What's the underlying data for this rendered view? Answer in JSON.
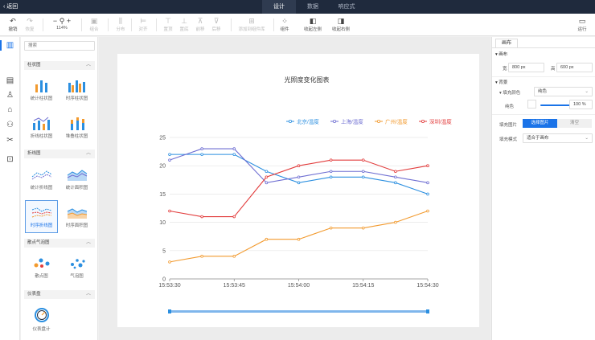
{
  "topbar": {
    "back_label": "返回",
    "tabs": [
      "设计",
      "数据",
      "响应式"
    ]
  },
  "toolbar": {
    "undo": "撤销",
    "redo": "恢复",
    "zoom": "114%",
    "group": "组合",
    "distribute": "分布",
    "align": "对齐",
    "top": "置顶",
    "bottom": "置底",
    "move_up": "前移",
    "move_down": "后移",
    "add_to_template": "添加到组件库",
    "component": "组件",
    "collapse_left": "收起左侧",
    "collapse_right": "收起右侧",
    "run": "运行"
  },
  "panel": {
    "search_placeholder": "搜索",
    "categories": {
      "bar": "柱状图",
      "line": "折线图",
      "scatter": "散点气泡图",
      "gauge": "仪表盘"
    },
    "items": {
      "stat_bar": "统计柱状图",
      "timeseries_bar": "时序柱状图",
      "line_bar": "折线柱状图",
      "stacked_bar": "堆叠柱状图",
      "stat_line": "统计折线图",
      "stat_area": "统计面积图",
      "timeseries_line": "时序折线图",
      "timeseries_area": "时序面积图",
      "scatter": "散点图",
      "bubble": "气泡图",
      "gauge": "仪表盘计"
    }
  },
  "right": {
    "tab": "画布",
    "canvas_section": "画布",
    "width_label": "宽",
    "width_value": "800 px",
    "height_label": "高",
    "height_value": "600 px",
    "bg_section": "背景",
    "fill_color_label": "填充颜色",
    "fill_color_value": "纯色",
    "pure_color_label": "纯色",
    "opacity_value": "100 %",
    "fill_image_label": "填充图片",
    "select_image": "选择图片",
    "clear": "清空",
    "fill_mode_label": "填充模式",
    "fill_mode_value": "适合于画布"
  },
  "colors": {
    "accent": "#1a73e8",
    "topbar": "#1f2a3d"
  },
  "chart_data": {
    "type": "line",
    "title": "光照度变化图表",
    "x": [
      "15:53:30",
      "15:53:37.5",
      "15:53:45",
      "15:53:52.5",
      "15:54:00",
      "15:54:07.5",
      "15:54:15",
      "15:54:22.5",
      "15:54:30"
    ],
    "x_ticks": [
      "15:53:30",
      "15:53:45",
      "15:54:00",
      "15:54:15",
      "15:54:30"
    ],
    "ylim": [
      0,
      25
    ],
    "y_ticks": [
      0,
      5,
      10,
      15,
      20,
      25
    ],
    "grid": true,
    "legend_position": "top-right",
    "series": [
      {
        "name": "北京/温度",
        "color": "#2b8fe0",
        "values": [
          22,
          22,
          22,
          19,
          17,
          18,
          18,
          17,
          15
        ]
      },
      {
        "name": "上海/温度",
        "color": "#6e6ed2",
        "values": [
          21,
          23,
          23,
          17,
          18,
          19,
          19,
          18,
          17
        ]
      },
      {
        "name": "广州/温度",
        "color": "#f29a2e",
        "values": [
          3,
          4,
          4,
          7,
          7,
          9,
          9,
          10,
          12
        ]
      },
      {
        "name": "深圳/温度",
        "color": "#e23c3c",
        "values": [
          12,
          11,
          11,
          18,
          20,
          21,
          21,
          19,
          20
        ]
      }
    ]
  }
}
